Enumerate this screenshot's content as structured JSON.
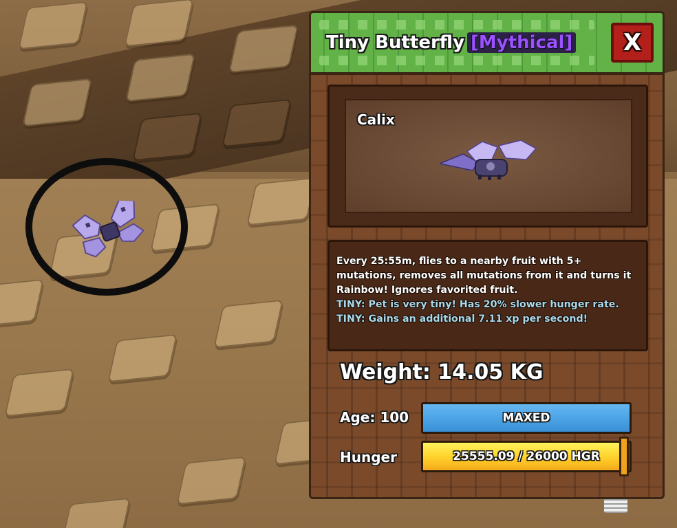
{
  "panel": {
    "title": "Tiny Butterfly",
    "rarity": "[Mythical]",
    "close_label": "X",
    "pet_name": "Calix",
    "description": [
      "Every 25:55m, flies to a nearby fruit with 5+",
      "mutations, removes all mutations from it and turns it",
      "Rainbow! Ignores favorited fruit."
    ],
    "tiny_traits": [
      "TINY: Pet is very tiny! Has 20% slower hunger rate.",
      "TINY: Gains an additional 7.11 xp per second!"
    ],
    "weight_text": "Weight: 14.05 KG",
    "age_label": "Age: 100",
    "age_bar_text": "MAXED",
    "age_fraction": 1.0,
    "hunger_label": "Hunger",
    "hunger_text": "25555.09 / 26000 HGR",
    "hunger_current": 25555.09,
    "hunger_max": 26000
  },
  "colors": {
    "header_green": "#62b248",
    "panel_brown": "#7a4a2b",
    "rarity_purple": "#9a52ff",
    "close_red": "#b3201c",
    "age_blue": "#4aa3e6",
    "hunger_yellow": "#ffd02a",
    "tiny_text": "#a9d8ea"
  },
  "icons": {
    "world_pet": "butterfly-pet-icon",
    "preview_pet": "butterfly-pet-icon",
    "selection_ring": "selection-ring-icon"
  }
}
